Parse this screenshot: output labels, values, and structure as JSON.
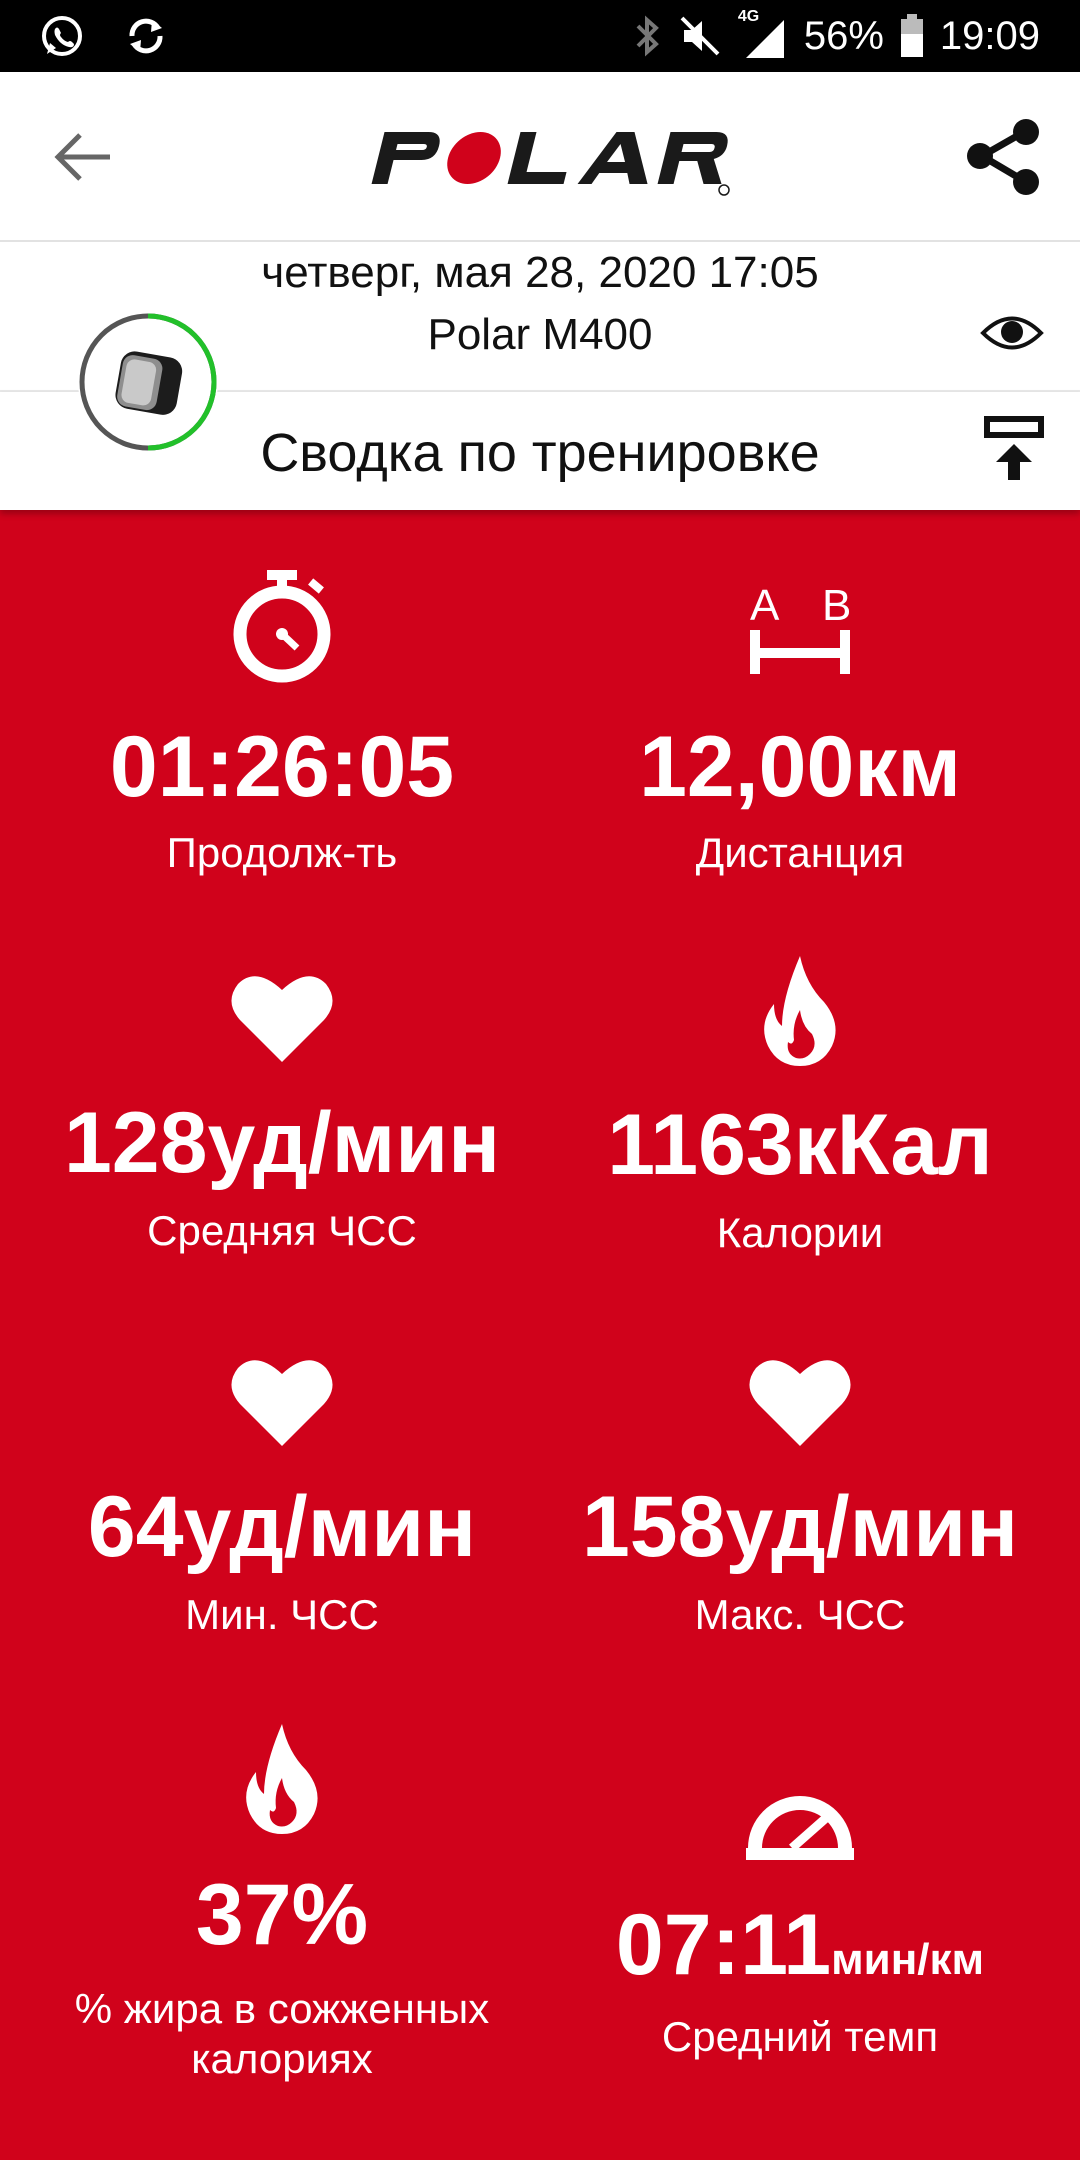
{
  "status_bar": {
    "battery_percent": "56%",
    "time": "19:09",
    "network": "4G",
    "icons": [
      "whatsapp-icon",
      "sync-icon",
      "bluetooth-icon",
      "mute-icon",
      "signal-icon",
      "battery-icon"
    ]
  },
  "header": {
    "logo_text": "POLAR",
    "back_icon": "arrow-left-icon",
    "share_icon": "share-icon"
  },
  "session": {
    "date": "четверг, мая 28, 2020 17:05",
    "device": "Polar M400",
    "title": "Сводка по тренировке"
  },
  "colors": {
    "accent": "#d0021b",
    "logo_red": "#d0021b",
    "avatar_ring": "#22c02a"
  },
  "stats": [
    {
      "icon": "stopwatch-icon",
      "value": "01:26:05",
      "label": "Продолж-ть"
    },
    {
      "icon": "distance-ab-icon",
      "value": "12,00км",
      "label": "Дистанция"
    },
    {
      "icon": "heart-icon",
      "value": "128уд/мин",
      "label": "Средняя ЧСС"
    },
    {
      "icon": "flame-icon",
      "value": "1163кКал",
      "label": "Калории"
    },
    {
      "icon": "heart-icon",
      "value": "64уд/мин",
      "label": "Мин. ЧСС"
    },
    {
      "icon": "heart-icon",
      "value": "158уд/мин",
      "label": "Макс. ЧСС"
    },
    {
      "icon": "flame-icon",
      "value": "37%",
      "label_line1": "% жира в сожженных",
      "label_line2": "калориях"
    },
    {
      "icon": "speedometer-icon",
      "value": "07:11",
      "unit": "мин/км",
      "label": "Средний темп"
    }
  ]
}
